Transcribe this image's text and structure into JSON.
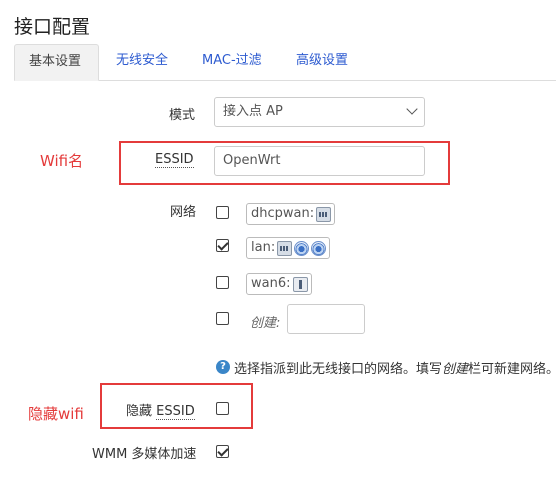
{
  "page": {
    "title": "接口配置"
  },
  "tabs": [
    {
      "label": "基本设置",
      "active": true
    },
    {
      "label": "无线安全"
    },
    {
      "label": "MAC-过滤"
    },
    {
      "label": "高级设置"
    }
  ],
  "mode": {
    "label": "模式",
    "value": "接入点 AP"
  },
  "essid": {
    "label": "ESSID",
    "value": "OpenWrt"
  },
  "network": {
    "label": "网络",
    "options": [
      {
        "name": "dhcpwan:",
        "checked": false,
        "icons": [
          "ethernet-icon"
        ]
      },
      {
        "name": "lan:",
        "checked": true,
        "icons": [
          "ethernet-icon",
          "wifi-icon",
          "wifi-icon"
        ]
      },
      {
        "name": "wan6:",
        "checked": false,
        "icons": [
          "usb-icon"
        ]
      }
    ],
    "create_label": "创建:",
    "create_value": "",
    "help_prefix": "选择指派到此无线接口的网络。填写",
    "help_italic": "创建",
    "help_suffix": "栏可新建网络。"
  },
  "hidden_essid": {
    "label_prefix": "隐藏 ",
    "label_term": "ESSID",
    "checked": false
  },
  "wmm": {
    "label": "WMM 多媒体加速",
    "checked": true
  },
  "annotations": {
    "wifi_name": "Wifi名",
    "hide_wifi": "隐藏wifi",
    "color": "#e43b3b"
  }
}
